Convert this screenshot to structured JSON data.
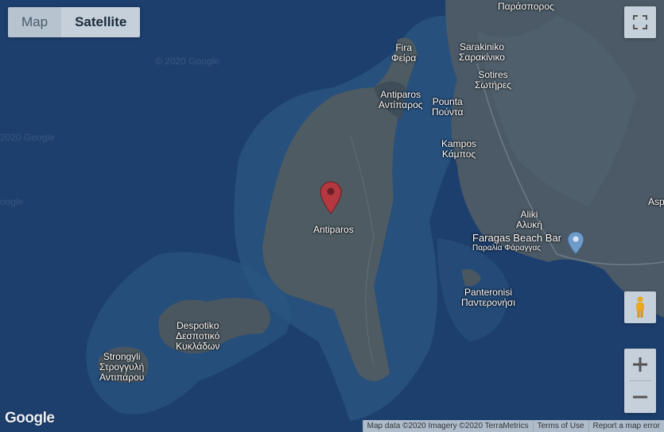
{
  "map_type": {
    "map_label": "Map",
    "satellite_label": "Satellite",
    "selected": "Satellite"
  },
  "places": {
    "paraspor": "Παράσπορος",
    "fira": "Fira",
    "fira_gr": "Φείρα",
    "sarakiniko": "Sarakiniko",
    "sarakiniko_gr": "Σαρακίνικο",
    "sotires": "Sotires",
    "sotires_gr": "Σωτήρες",
    "antiparos_n": "Antiparos",
    "antiparos_n_gr": "Αντίπαρος",
    "pounta": "Pounta",
    "pounta_gr": "Πούντα",
    "kampos": "Kampos",
    "kampos_gr": "Κάμπος",
    "antiparos_marker": "Antiparos",
    "aliki": "Aliki",
    "aliki_gr": "Αλυκή",
    "faragas": "Faragas Beach Bar",
    "faragas_gr": "Παραλία Φάραγγας",
    "panteronisi": "Panteronisi",
    "panteronisi_gr": "Παντερονήσι",
    "despotiko": "Despotiko",
    "despotiko_gr1": "Δεσποτικό",
    "despotiko_gr2": "Κυκλάδων",
    "strongyli": "Strongyli",
    "strongyli_gr1": "Στρογγυλή",
    "strongyli_gr2": "Αντιπάρου",
    "edge_asp": "Asp"
  },
  "watermarks": {
    "w1": "© 2020 Google",
    "w2": "2020 Google",
    "w3": "oogle"
  },
  "attribution": {
    "map_data": "Map data ©2020 Imagery ©2020 TerraMetrics",
    "terms": "Terms of Use",
    "report": "Report a map error"
  },
  "logo": "Google",
  "icons": {
    "fullscreen": "fullscreen-icon",
    "pegman": "pegman-icon",
    "zoom_in": "plus-icon",
    "zoom_out": "minus-icon",
    "marker": "map-pin-icon"
  },
  "colors": {
    "sea": "#1d3f6e",
    "land": "#4a5a66",
    "marker": "#b3383f",
    "control_bg": "#c5d0da"
  }
}
